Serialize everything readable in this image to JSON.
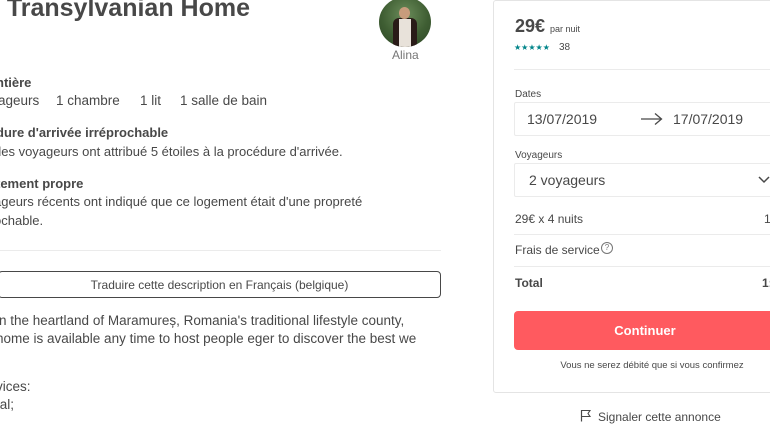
{
  "listing": {
    "title": "y Transylvanian Home",
    "host_name": "Alina",
    "type_title": "ntière",
    "stats": [
      "ageurs",
      "1 chambre",
      "1 lit",
      "1 salle de bain"
    ],
    "highlights": [
      {
        "title": "dure d'arrivée irréprochable",
        "text": [
          "des voyageurs ont attribué 5 étoiles à la procédure d'arrivée."
        ]
      },
      {
        "title": "tement propre",
        "text": [
          "ageurs récents ont indiqué que ce logement était d'une propreté",
          "ochable."
        ]
      }
    ],
    "translate_label": "Traduire cette description en Français (belgique)",
    "description": [
      "in the heartland of Maramureș, Romania's traditional lifestyle county,",
      "home is available any time to host people eger to discover the best we",
      "",
      "vices:",
      "tal;"
    ]
  },
  "booking": {
    "price": "29€",
    "price_unit": "par nuit",
    "rating_stars": 5,
    "rating_display": "★★★★★",
    "review_count": "38",
    "dates_label": "Dates",
    "check_in": "13/07/2019",
    "check_out": "17/07/2019",
    "guests_label": "Voyageurs",
    "guests_value": "2 voyageurs",
    "nightly_line": "29€ x 4 nuits",
    "nightly_total": "1",
    "service_fee_label": "Frais de service",
    "total_label": "Total",
    "total_value": "1:",
    "continue_label": "Continuer",
    "note": "Vous ne serez débité que si vous confirmez",
    "report_label": "Signaler cette annonce"
  },
  "colors": {
    "accent": "#ff5a5f",
    "rating": "#008489",
    "text": "#484848"
  },
  "icons": [
    "arrow-right-icon",
    "chevron-down-icon",
    "help-circle-icon",
    "flag-icon"
  ]
}
